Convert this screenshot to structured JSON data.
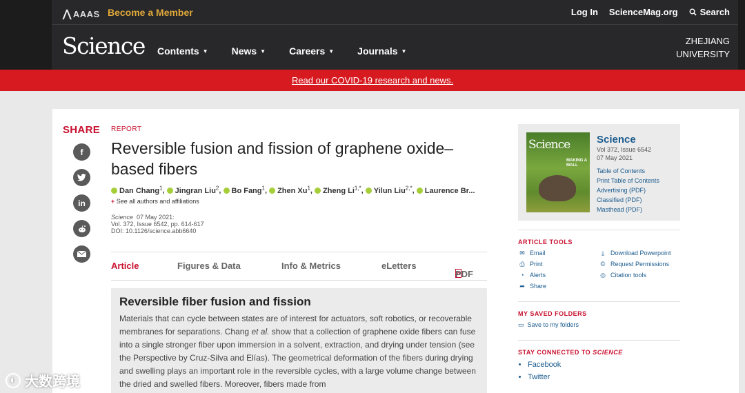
{
  "header": {
    "aaas": "AAAS",
    "become_member": "Become a Member",
    "log_in": "Log In",
    "sciencemag": "ScienceMag.org",
    "search": "Search"
  },
  "nav": {
    "logo": "Science",
    "items": [
      {
        "label": "Contents"
      },
      {
        "label": "News"
      },
      {
        "label": "Careers"
      },
      {
        "label": "Journals"
      }
    ],
    "institution_line1": "ZHEJIANG",
    "institution_line2": "UNIVERSITY"
  },
  "banner": {
    "text": "Read our COVID-19 research and news."
  },
  "share": {
    "label": "SHARE",
    "icons": [
      "facebook-icon",
      "twitter-icon",
      "linkedin-icon",
      "reddit-icon",
      "email-icon"
    ]
  },
  "article": {
    "type": "REPORT",
    "title": "Reversible fusion and fission of graphene oxide–based fibers",
    "authors": [
      {
        "name": "Dan Chang",
        "sup": "1"
      },
      {
        "name": "Jingran Liu",
        "sup": "2"
      },
      {
        "name": "Bo Fang",
        "sup": "1"
      },
      {
        "name": "Zhen Xu",
        "sup": "1"
      },
      {
        "name": "Zheng Li",
        "sup": "1,*"
      },
      {
        "name": "Yilun Liu",
        "sup": "2,*"
      },
      {
        "name": "Laurence Br...",
        "sup": ""
      }
    ],
    "see_all": "See all authors and affiliations",
    "journal": "Science",
    "date": "07 May 2021:",
    "volume": "Vol. 372, Issue 6542, pp. 614-617",
    "doi": "DOI: 10.1126/science.abb6640"
  },
  "tabs": [
    {
      "label": "Article"
    },
    {
      "label": "Figures & Data"
    },
    {
      "label": "Info & Metrics"
    },
    {
      "label": "eLetters"
    },
    {
      "label": "PDF"
    }
  ],
  "abstract": {
    "heading": "Reversible fiber fusion and fission",
    "text_before": "Materials that can cycle between states are of interest for actuators, soft robotics, or recoverable membranes for separations. Chang ",
    "text_italic": "et al.",
    "text_after": " show that a collection of graphene oxide fibers can fuse into a single stronger fiber upon immersion in a solvent, extraction, and drying under tension (see the Perspective by Cruz-Silva and Elías). The geometrical deformation of the fibers during drying and swelling plays an important role in the reversible cycles, with a large volume change between the dried and swelled fibers. Moreover, fibers made from"
  },
  "issue": {
    "cover_title": "Science",
    "cover_subtitle": "MAKING A MALL",
    "journal": "Science",
    "volume": "Vol 372, Issue 6542",
    "date": "07 May 2021",
    "links": [
      "Table of Contents",
      "Print Table of Contents",
      "Advertising (PDF)",
      "Classified (PDF)",
      "Masthead (PDF)"
    ]
  },
  "article_tools": {
    "title": "ARTICLE TOOLS",
    "items": [
      {
        "label": "Email",
        "icon": "envelope-icon"
      },
      {
        "label": "Download Powerpoint",
        "icon": "download-icon"
      },
      {
        "label": "Print",
        "icon": "print-icon"
      },
      {
        "label": "Request Permissions",
        "icon": "copyright-icon"
      },
      {
        "label": "Alerts",
        "icon": "bell-icon"
      },
      {
        "label": "Citation tools",
        "icon": "cite-icon"
      },
      {
        "label": "Share",
        "icon": "share-icon"
      }
    ]
  },
  "saved_folders": {
    "title": "MY SAVED FOLDERS",
    "save_label": "Save to my folders"
  },
  "stay_connected": {
    "title_prefix": "STAY CONNECTED TO ",
    "title_journal": "SCIENCE",
    "links": [
      "Facebook",
      "Twitter"
    ]
  },
  "watermark": {
    "text": "大数跨境"
  }
}
